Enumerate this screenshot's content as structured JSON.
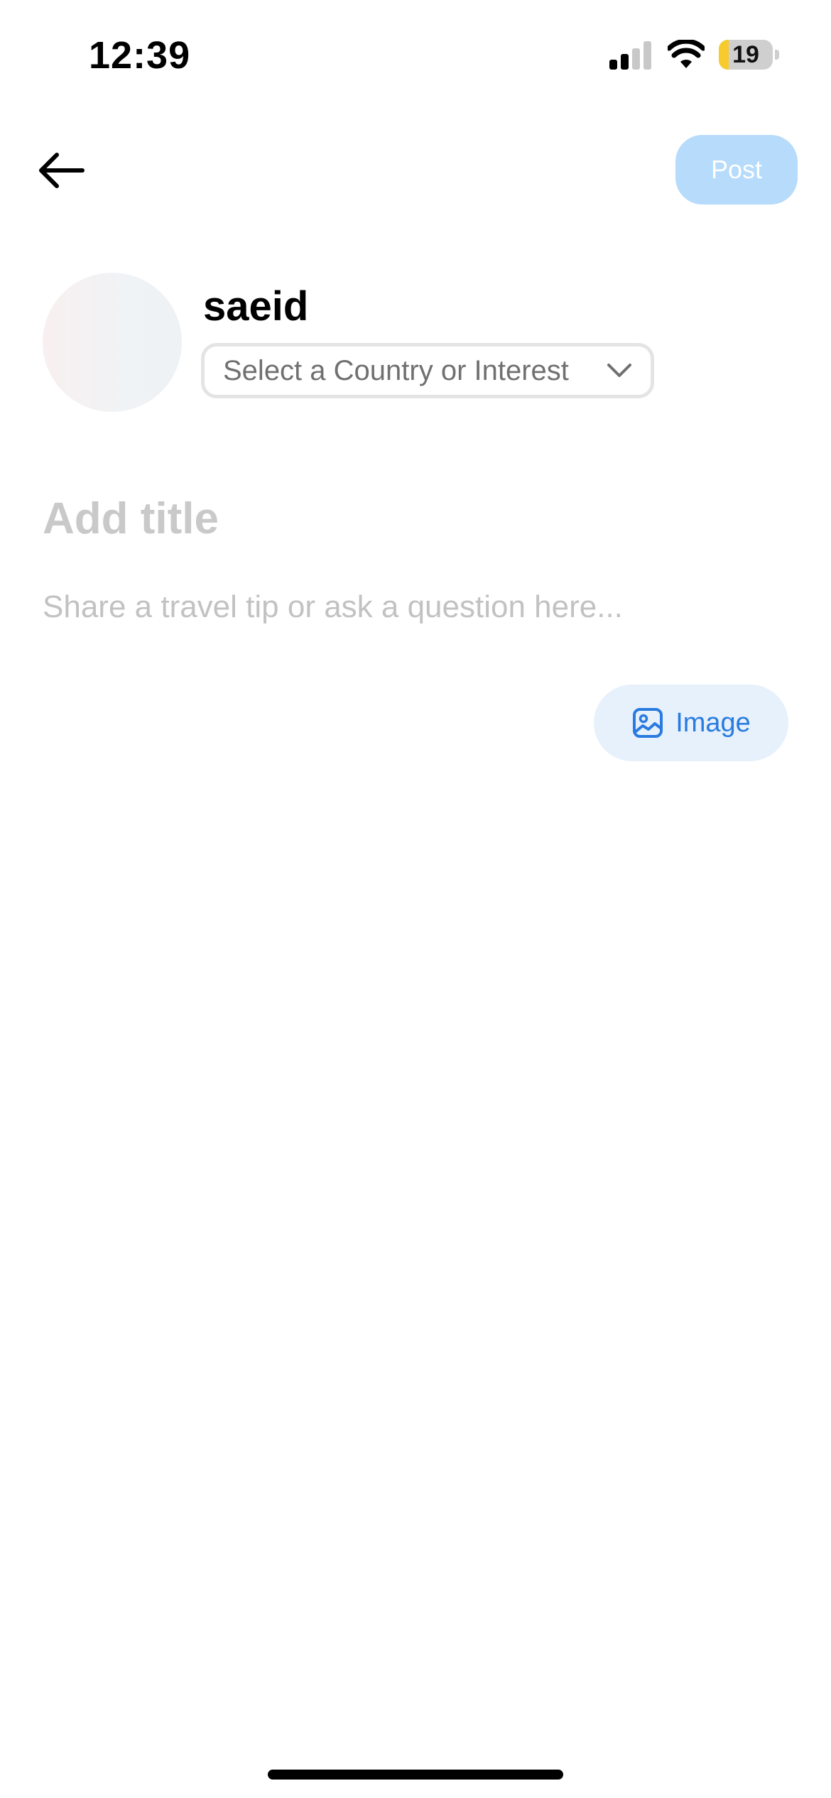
{
  "status_bar": {
    "time": "12:39",
    "battery_level": "19",
    "battery_fill_fraction": 0.19,
    "signal_bars_active": 2,
    "signal_bars_total": 4
  },
  "header": {
    "back_icon": "arrow-left-icon",
    "post_label": "Post"
  },
  "user": {
    "name": "saeid"
  },
  "country_select": {
    "placeholder": "Select a Country or Interest",
    "chevron_icon": "chevron-down-icon"
  },
  "post_form": {
    "title_placeholder": "Add title",
    "body_placeholder": "Share a travel tip or ask a question here...",
    "image_button_label": "Image",
    "image_icon": "image-icon"
  },
  "colors": {
    "accent": "#2a7be0",
    "post_button_disabled": "#b6dbfb",
    "image_button_bg": "#e6f1fc"
  }
}
